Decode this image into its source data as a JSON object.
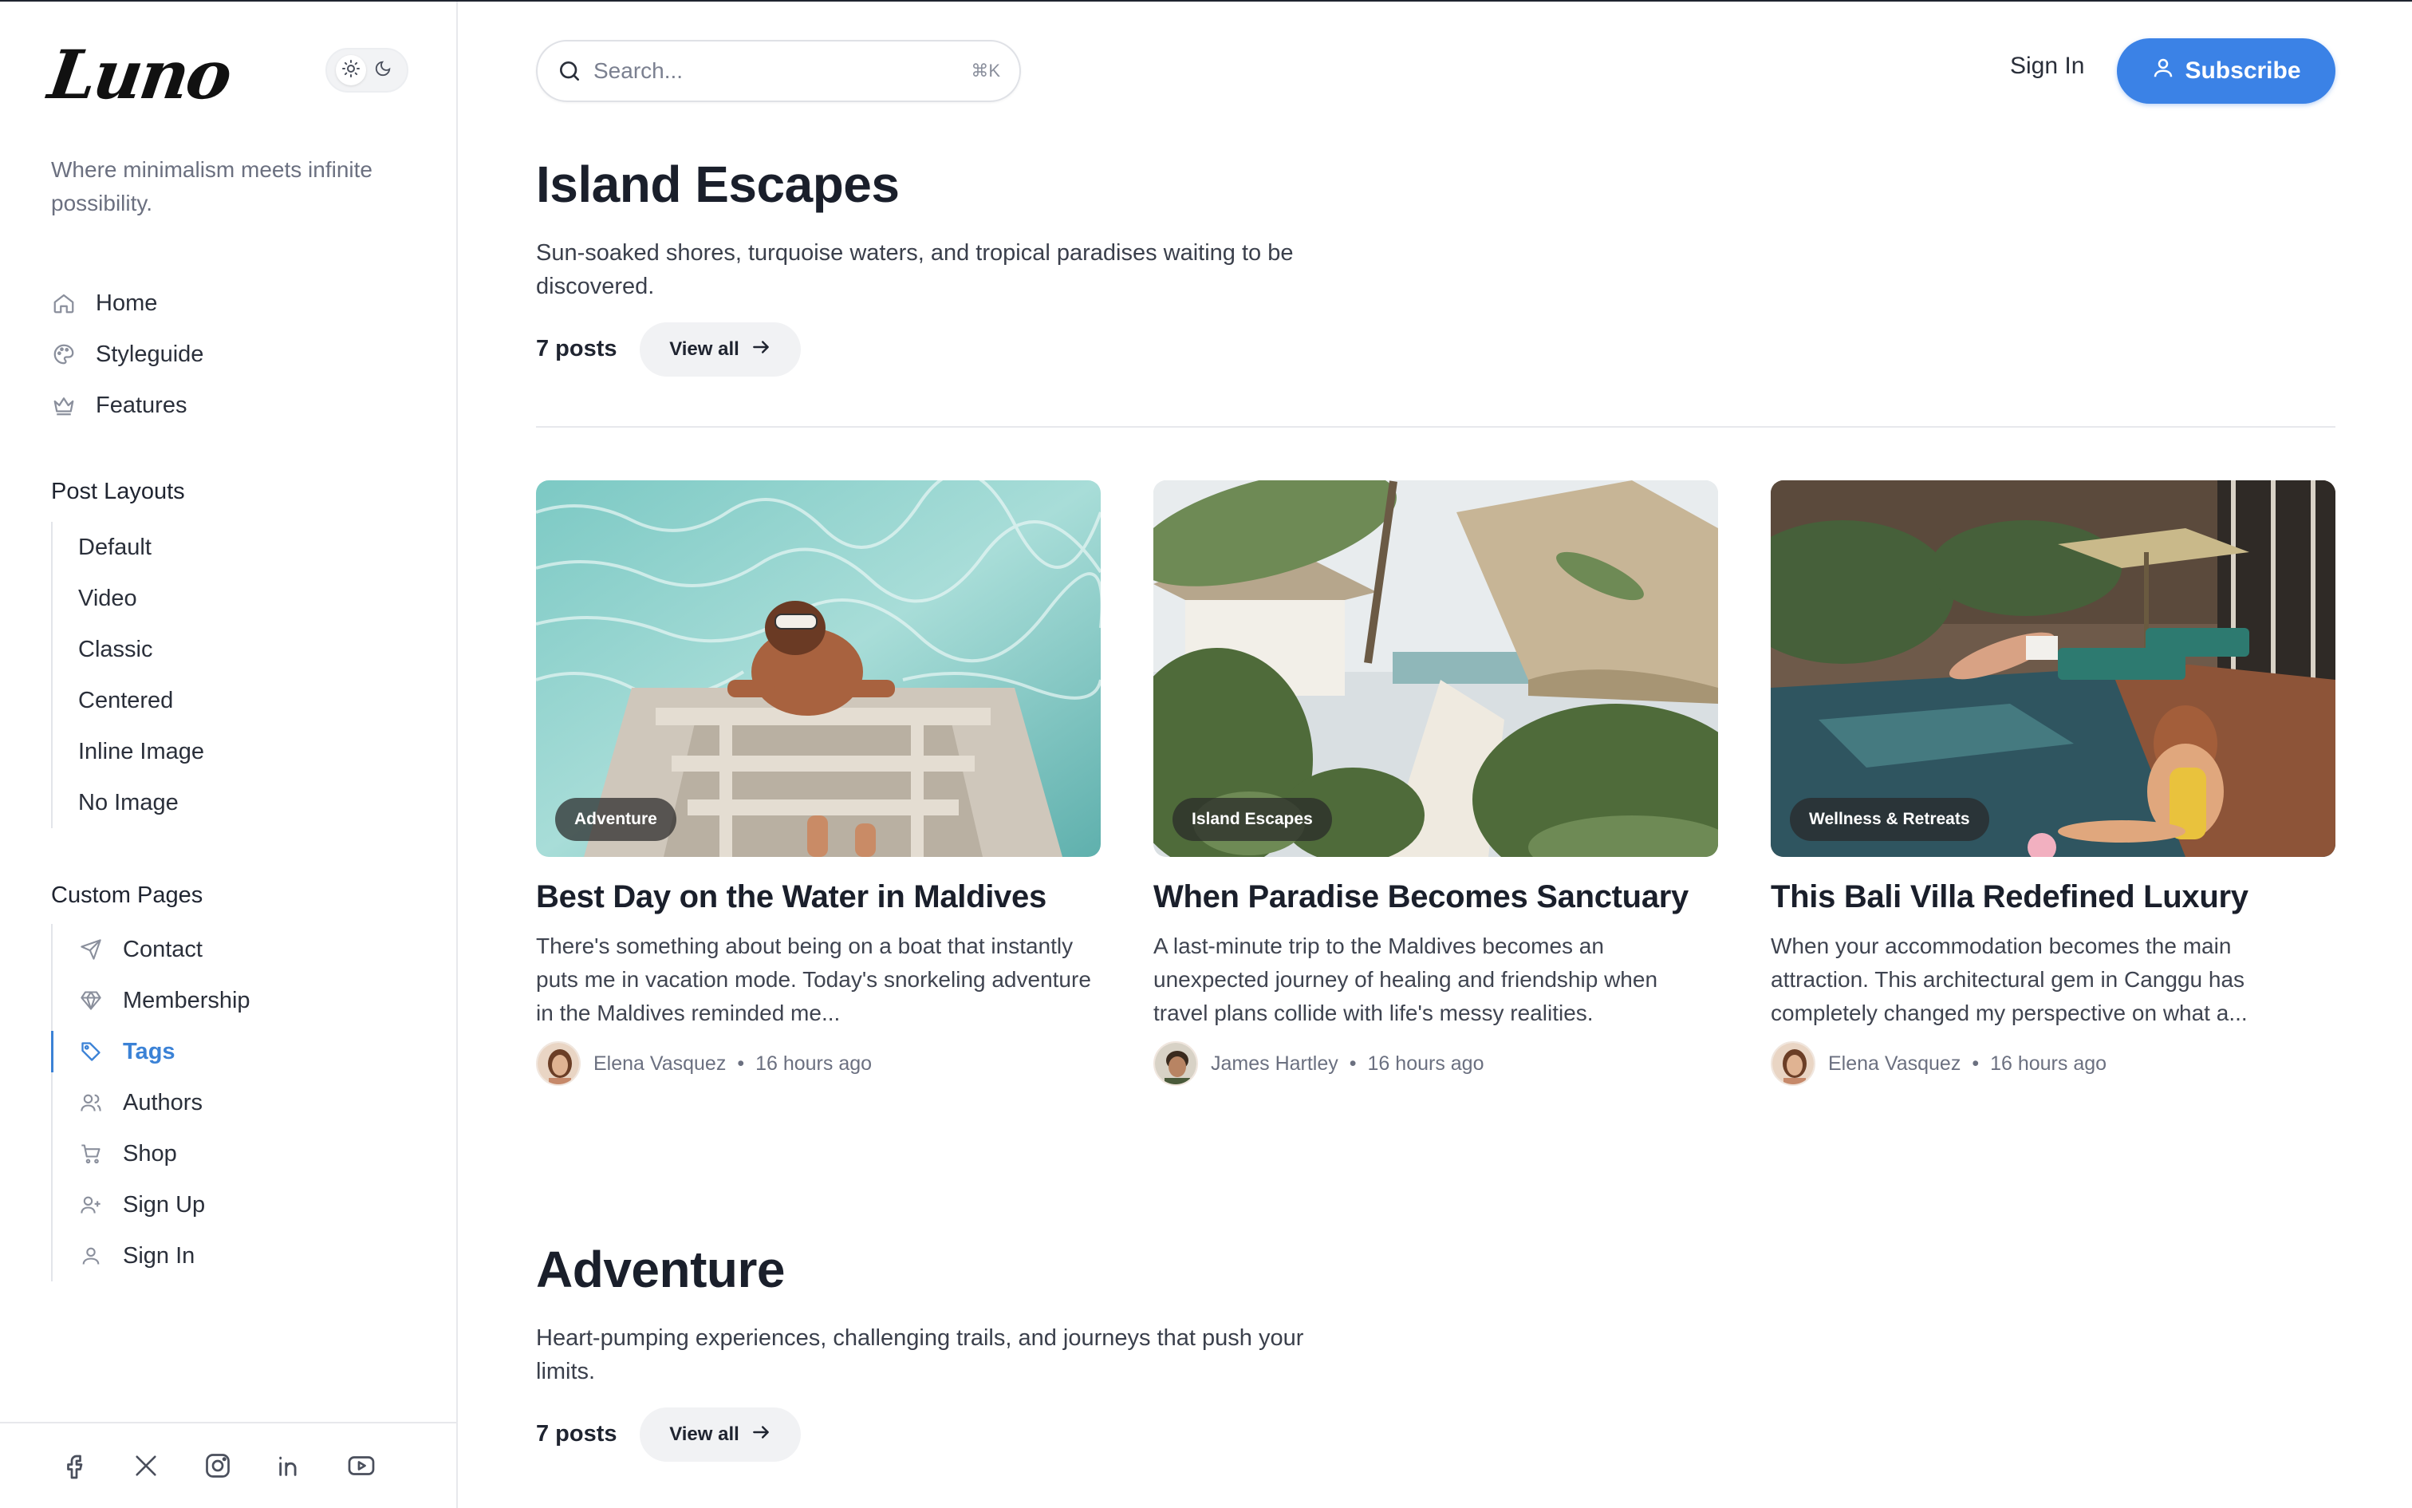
{
  "brand": {
    "logo": "Luno",
    "tagline": "Where minimalism meets infinite possibility."
  },
  "nav": [
    {
      "label": "Home",
      "icon": "home-icon"
    },
    {
      "label": "Styleguide",
      "icon": "palette-icon"
    },
    {
      "label": "Features",
      "icon": "crown-icon"
    }
  ],
  "post_layouts": {
    "title": "Post Layouts",
    "items": [
      "Default",
      "Video",
      "Classic",
      "Centered",
      "Inline Image",
      "No Image"
    ]
  },
  "custom_pages": {
    "title": "Custom Pages",
    "items": [
      {
        "label": "Contact",
        "icon": "send-icon",
        "active": false
      },
      {
        "label": "Membership",
        "icon": "diamond-icon",
        "active": false
      },
      {
        "label": "Tags",
        "icon": "tag-icon",
        "active": true
      },
      {
        "label": "Authors",
        "icon": "users-icon",
        "active": false
      },
      {
        "label": "Shop",
        "icon": "cart-icon",
        "active": false
      },
      {
        "label": "Sign Up",
        "icon": "user-plus-icon",
        "active": false
      },
      {
        "label": "Sign In",
        "icon": "user-icon",
        "active": false
      }
    ]
  },
  "social": [
    "facebook-icon",
    "x-icon",
    "instagram-icon",
    "linkedin-icon",
    "youtube-icon"
  ],
  "header": {
    "search_placeholder": "Search...",
    "search_shortcut": "⌘K",
    "signin": "Sign In",
    "subscribe": "Subscribe"
  },
  "sections": [
    {
      "title": "Island Escapes",
      "description": "Sun-soaked shores, turquoise waters, and tropical paradises waiting to be discovered.",
      "count": "7 posts",
      "view_all": "View all"
    },
    {
      "title": "Adventure",
      "description": "Heart-pumping experiences, challenging trails, and journeys that push your limits.",
      "count": "7 posts",
      "view_all": "View all"
    }
  ],
  "posts": [
    {
      "tag": "Adventure",
      "title": "Best Day on the Water in Maldives",
      "excerpt": "There's something about being on a boat that instantly puts me in vacation mode. Today's snorkeling adventure in the Maldives reminded me...",
      "author": "Elena Vasquez",
      "time": "16 hours ago"
    },
    {
      "tag": "Island Escapes",
      "title": "When Paradise Becomes Sanctuary",
      "excerpt": "A last-minute trip to the Maldives becomes an unexpected journey of healing and friendship when travel plans collide with life's messy realities.",
      "author": "James Hartley",
      "time": "16 hours ago"
    },
    {
      "tag": "Wellness & Retreats",
      "title": "This Bali Villa Redefined Luxury",
      "excerpt": "When your accommodation becomes the main attraction. This architectural gem in Canggu has completely changed my perspective on what a...",
      "author": "Elena Vasquez",
      "time": "16 hours ago"
    }
  ]
}
